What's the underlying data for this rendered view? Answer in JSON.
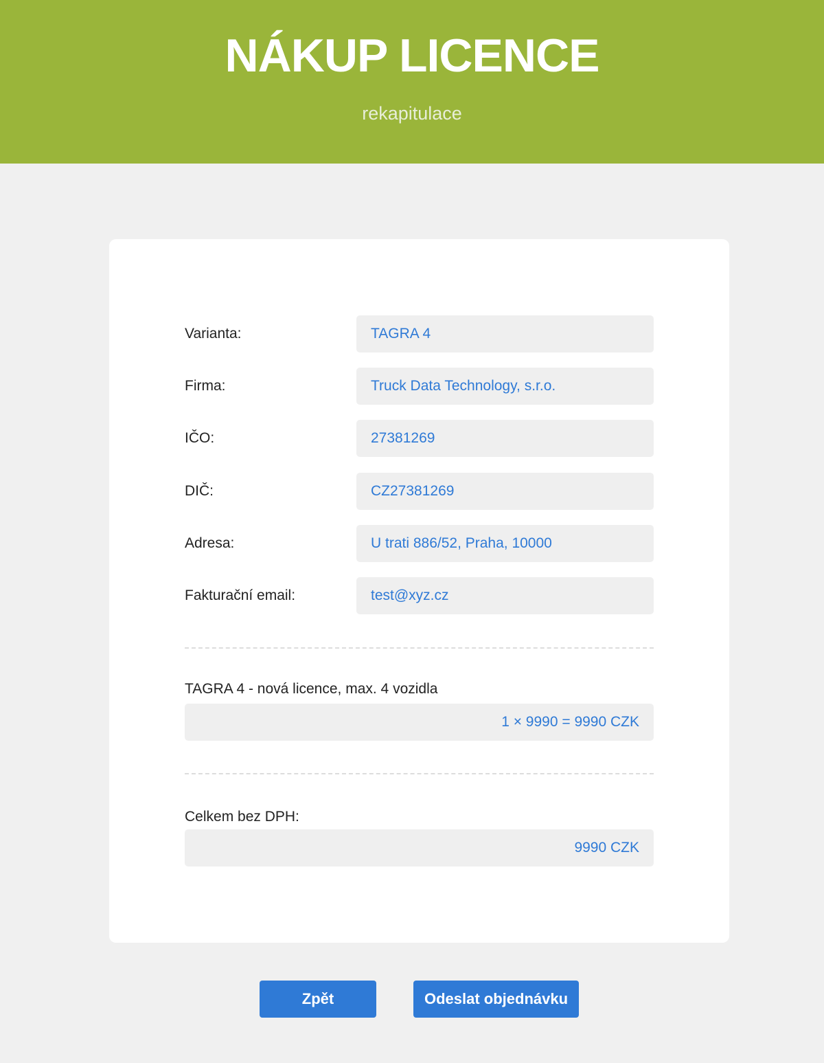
{
  "header": {
    "title": "NÁKUP LICENCE",
    "subtitle": "rekapitulace"
  },
  "summary": {
    "fields": [
      {
        "label": "Varianta:",
        "value": "TAGRA 4"
      },
      {
        "label": "Firma:",
        "value": "Truck Data Technology, s.r.o."
      },
      {
        "label": "IČO:",
        "value": "27381269"
      },
      {
        "label": "DIČ:",
        "value": "CZ27381269"
      },
      {
        "label": "Adresa:",
        "value": "U trati 886/52, Praha, 10000"
      },
      {
        "label": "Fakturační email:",
        "value": "test@xyz.cz"
      }
    ],
    "item": {
      "label": "TAGRA 4 - nová licence, max. 4 vozidla",
      "value": "1 × 9990 = 9990 CZK"
    },
    "total": {
      "label": "Celkem bez DPH:",
      "value": "9990 CZK"
    }
  },
  "actions": {
    "back_label": "Zpět",
    "submit_label": "Odeslat objednávku"
  },
  "colors": {
    "header_bg": "#9ab53a",
    "value_text": "#2f7ad6",
    "button_bg": "#2f7ad6",
    "page_bg": "#f0f0f0"
  }
}
